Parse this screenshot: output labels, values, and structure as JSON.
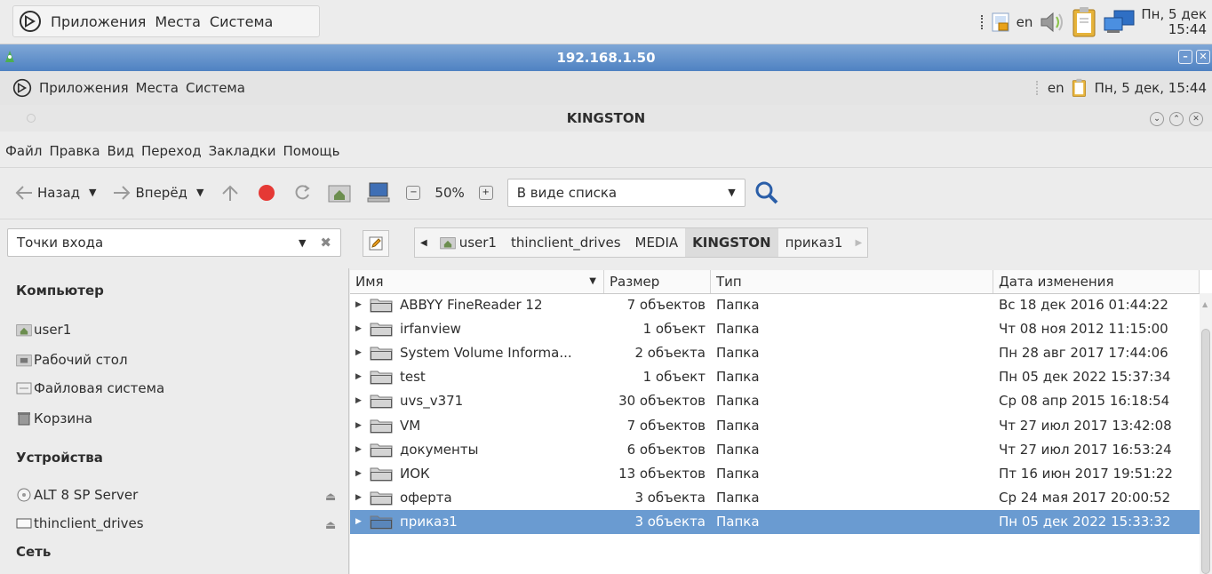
{
  "host_panel": {
    "menu": [
      "Приложения",
      "Места",
      "Система"
    ],
    "lang": "en",
    "clock_line1": "Пн, 5 дек",
    "clock_line2": "15:44"
  },
  "remote_window": {
    "title": "192.168.1.50"
  },
  "remote_panel": {
    "menu": [
      "Приложения",
      "Места",
      "Система"
    ],
    "lang": "en",
    "clock": "Пн, 5 дек, 15:44"
  },
  "fm": {
    "title": "KINGSTON",
    "menubar": [
      "Файл",
      "Правка",
      "Вид",
      "Переход",
      "Закладки",
      "Помощь"
    ],
    "toolbar": {
      "back": "Назад",
      "forward": "Вперёд",
      "zoom": "50%",
      "view_mode": "В виде списка"
    },
    "sidebar_mode": "Точки входа",
    "breadcrumbs": [
      "user1",
      "thinclient_drives",
      "MEDIA",
      "KINGSTON",
      "приказ1"
    ],
    "sidebar": {
      "computer_header": "Компьютер",
      "computer_items": [
        "user1",
        "Рабочий стол",
        "Файловая система",
        "Корзина"
      ],
      "devices_header": "Устройства",
      "devices_items": [
        "ALT 8 SP Server",
        "thinclient_drives"
      ],
      "network_header": "Сеть"
    },
    "columns": {
      "name": "Имя",
      "size": "Размер",
      "type": "Тип",
      "modified": "Дата изменения"
    },
    "rows": [
      {
        "name": "ABBYY FineReader 12",
        "size": "7 объектов",
        "type": "Папка",
        "modified": "Вс 18 дек 2016 01:44:22"
      },
      {
        "name": "irfanview",
        "size": "1 объект",
        "type": "Папка",
        "modified": "Чт 08 ноя 2012 11:15:00"
      },
      {
        "name": "System Volume Informa...",
        "size": "2 объекта",
        "type": "Папка",
        "modified": "Пн 28 авг 2017 17:44:06"
      },
      {
        "name": "test",
        "size": "1 объект",
        "type": "Папка",
        "modified": "Пн 05 дек 2022 15:37:34"
      },
      {
        "name": "uvs_v371",
        "size": "30 объектов",
        "type": "Папка",
        "modified": "Ср 08 апр 2015 16:18:54"
      },
      {
        "name": "VM",
        "size": "7 объектов",
        "type": "Папка",
        "modified": "Чт 27 июл 2017 13:42:08"
      },
      {
        "name": "документы",
        "size": "6 объектов",
        "type": "Папка",
        "modified": "Чт 27 июл 2017 16:53:24"
      },
      {
        "name": "ИОК",
        "size": "13 объектов",
        "type": "Папка",
        "modified": "Пт 16 июн 2017 19:51:22"
      },
      {
        "name": "оферта",
        "size": "3 объекта",
        "type": "Папка",
        "modified": "Ср 24 мая 2017 20:00:52"
      },
      {
        "name": "приказ1",
        "size": "3 объекта",
        "type": "Папка",
        "modified": "Пн 05 дек 2022 15:33:32"
      }
    ]
  }
}
